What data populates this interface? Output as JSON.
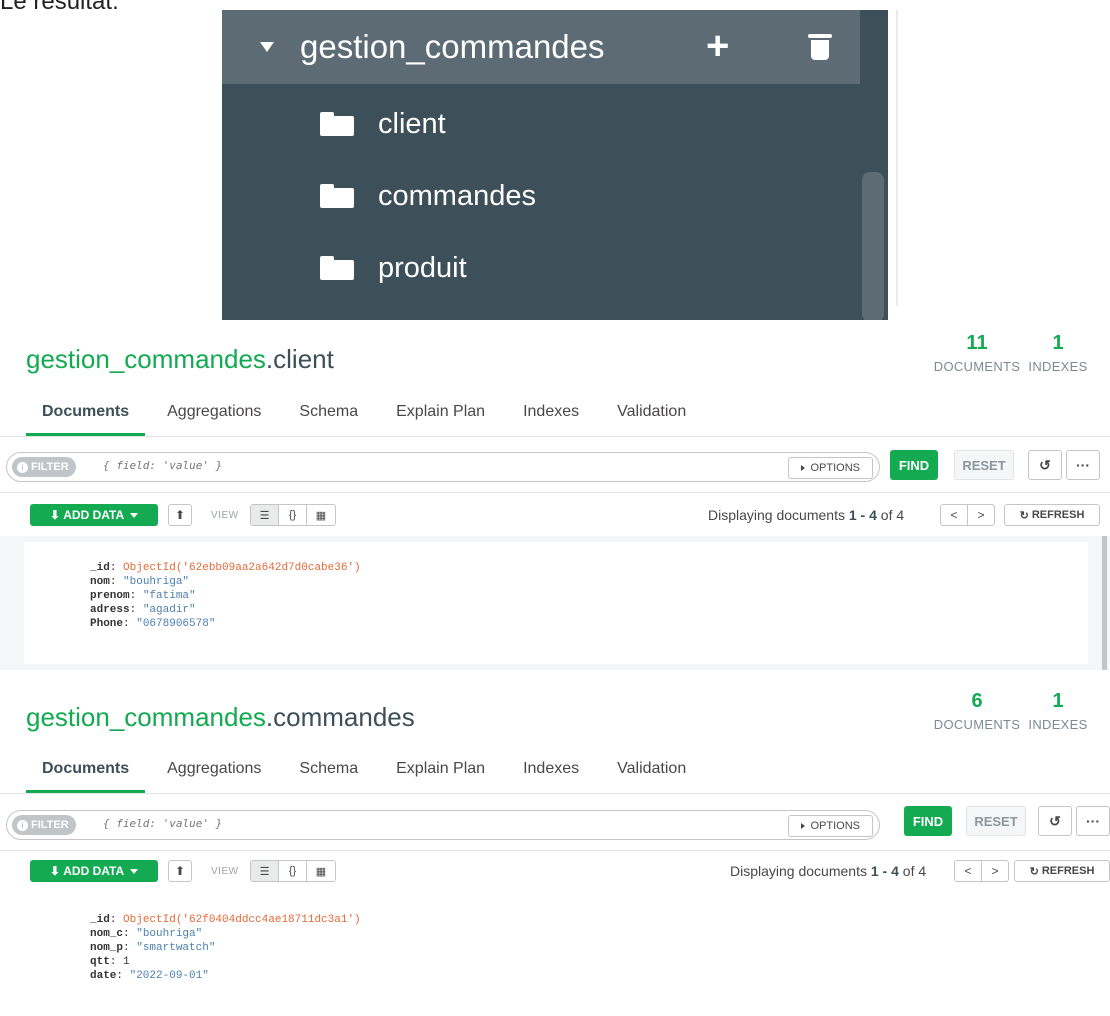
{
  "caption": "Le résultat:",
  "sidebar": {
    "database": "gestion_commandes",
    "collections": [
      "client",
      "commandes",
      "produit"
    ]
  },
  "panels": [
    {
      "db": "gestion_commandes",
      "collection": ".client",
      "documents_count": "11",
      "documents_label": "DOCUMENTS",
      "indexes_count": "1",
      "indexes_label": "INDEXES",
      "tabs": [
        "Documents",
        "Aggregations",
        "Schema",
        "Explain Plan",
        "Indexes",
        "Validation"
      ],
      "filter_label": "FILTER",
      "filter_placeholder": "{ field: 'value' }",
      "options_label": "OPTIONS",
      "find_label": "FIND",
      "reset_label": "RESET",
      "add_data_label": "ADD DATA",
      "view_label": "VIEW",
      "displaying_prefix": "Displaying documents",
      "range_start": "1",
      "range_sep": "-",
      "range_end": "4",
      "of_label": "of",
      "total": "4",
      "refresh_label": "REFRESH",
      "fields": [
        {
          "key": "_id",
          "value": "ObjectId('62ebb09aa2a642d7d0cabe36')",
          "type": "oid"
        },
        {
          "key": "nom",
          "value": "\"bouhriga\"",
          "type": "str"
        },
        {
          "key": "prenom",
          "value": "\"fatima\"",
          "type": "str"
        },
        {
          "key": "adress",
          "value": "\"agadir\"",
          "type": "str"
        },
        {
          "key": "Phone",
          "value": "\"0678906578\"",
          "type": "str"
        }
      ]
    },
    {
      "db": "gestion_commandes",
      "collection": ".commandes",
      "documents_count": "6",
      "documents_label": "DOCUMENTS",
      "indexes_count": "1",
      "indexes_label": "INDEXES",
      "tabs": [
        "Documents",
        "Aggregations",
        "Schema",
        "Explain Plan",
        "Indexes",
        "Validation"
      ],
      "filter_label": "FILTER",
      "filter_placeholder": "{ field: 'value' }",
      "options_label": "OPTIONS",
      "find_label": "FIND",
      "reset_label": "RESET",
      "add_data_label": "ADD DATA",
      "view_label": "VIEW",
      "displaying_prefix": "Displaying documents",
      "range_start": "1",
      "range_sep": "-",
      "range_end": "4",
      "of_label": "of",
      "total": "4",
      "refresh_label": "REFRESH",
      "fields": [
        {
          "key": "_id",
          "value": "ObjectId('62f0404ddcc4ae18711dc3a1')",
          "type": "oid"
        },
        {
          "key": "nom_c",
          "value": "\"bouhriga\"",
          "type": "str"
        },
        {
          "key": "nom_p",
          "value": "\"smartwatch\"",
          "type": "str"
        },
        {
          "key": "qtt",
          "value": "1",
          "type": "numv"
        },
        {
          "key": "date",
          "value": "\"2022-09-01\"",
          "type": "str"
        }
      ]
    }
  ]
}
